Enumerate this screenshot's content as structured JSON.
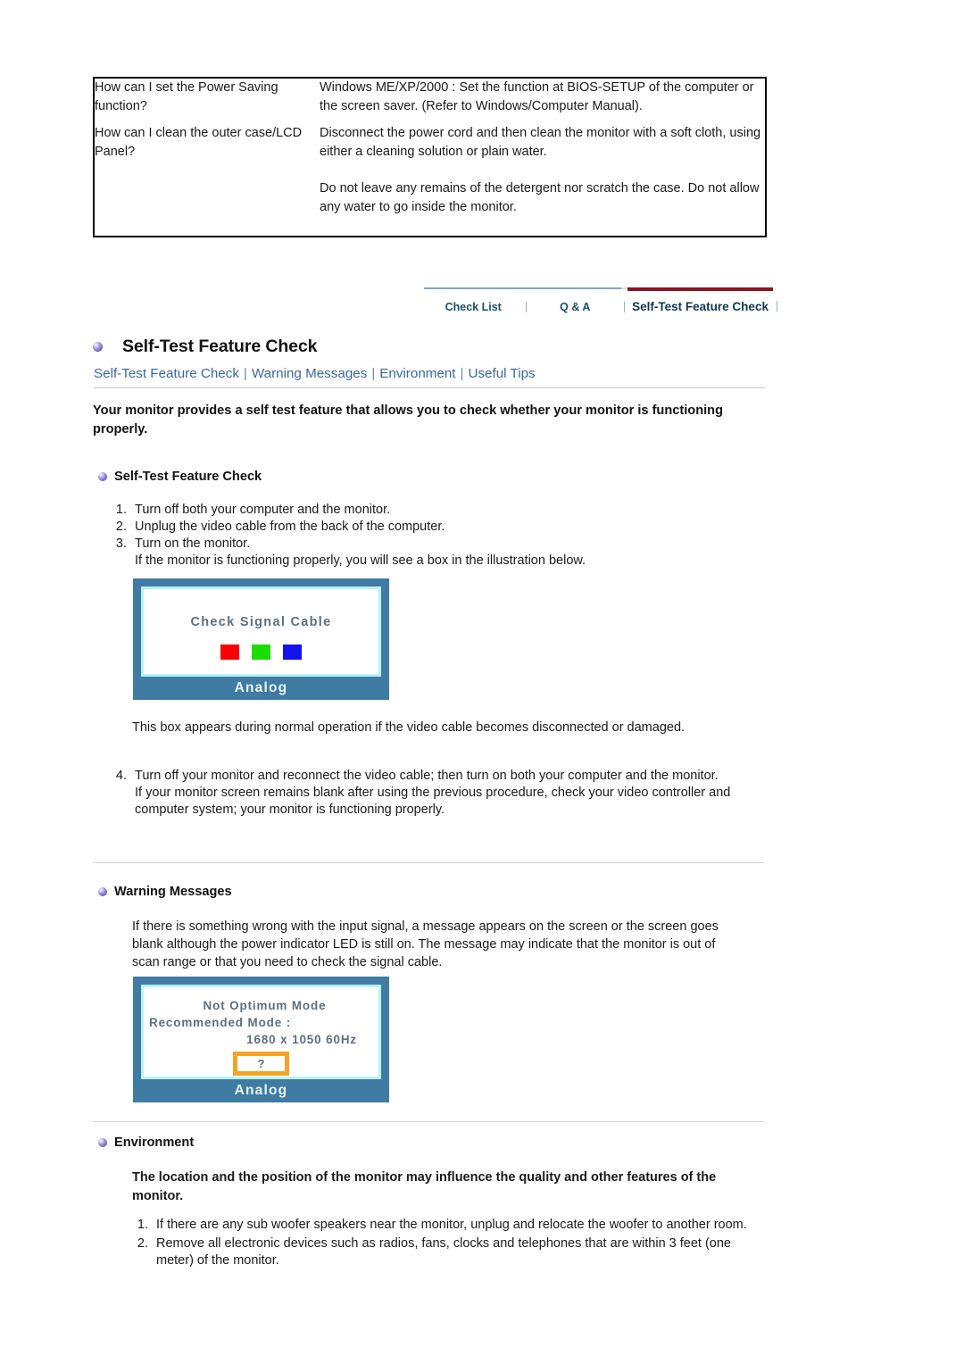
{
  "faq_table": {
    "rows": [
      {
        "question": "How can I set the Power Saving function?",
        "answers": [
          "Windows ME/XP/2000 : Set the function at BIOS-SETUP of the computer or the screen saver. (Refer to Windows/Computer Manual)."
        ]
      },
      {
        "question": "How can I clean the outer case/LCD Panel?",
        "answers": [
          "Disconnect the power cord and then clean the monitor with a soft cloth, using either a cleaning solution or plain water.",
          "Do not leave any remains of the detergent nor scratch the case. Do not allow any water to go inside the monitor."
        ]
      }
    ]
  },
  "tabbar": {
    "tabs": [
      {
        "label": "Check List",
        "active": false
      },
      {
        "label": "Q & A",
        "active": false
      },
      {
        "label": "Self-Test Feature Check",
        "active": true
      }
    ],
    "active_color": "#8c1322",
    "inactive_color": "#7fa8bd",
    "text_color": "#1c4f70"
  },
  "page": {
    "heading": "Self-Test Feature Check",
    "bullet_icon": "purple-sphere-bullet-icon"
  },
  "subnav": {
    "links": [
      "Self-Test Feature Check",
      "Warning Messages",
      "Environment",
      "Useful Tips"
    ],
    "separator": "|",
    "link_color": "#3a67a8"
  },
  "intro": "Your monitor provides a self test feature that allows you to check whether your monitor is functioning properly.",
  "sections": {
    "self_test": {
      "heading": "Self-Test Feature Check",
      "steps": [
        {
          "num": "1.",
          "text": "Turn off both your computer and the monitor."
        },
        {
          "num": "2.",
          "text": "Unplug the video cable from the back of the computer."
        },
        {
          "num": "3.",
          "text": "Turn on the monitor.\nIf the monitor is functioning properly, you will see a box in the illustration below."
        }
      ],
      "after_image_para": "This box appears during normal operation if the video cable becomes disconnected or damaged.",
      "step4": {
        "num": "4.",
        "text": "Turn off your monitor and reconnect the video cable; then turn on both your computer and the monitor.\nIf your monitor screen remains blank after using the previous procedure, check your video controller and computer system; your monitor is functioning properly."
      }
    },
    "warning": {
      "heading": "Warning Messages",
      "paragraph": "If there is something wrong with the input signal, a message appears on the screen or the screen goes blank although the power indicator LED is still on. The message may indicate that the monitor is out of scan range or that you need to check the signal cable."
    },
    "environment": {
      "heading": "Environment",
      "lead": "The location and the position of the monitor may influence the quality and other features of the monitor.",
      "items": [
        {
          "num": "1.",
          "text": "If there are any sub woofer speakers near the monitor, unplug and relocate the woofer to another room."
        },
        {
          "num": "2.",
          "text": "Remove all electronic devices such as radios, fans, clocks and telephones that are within 3 feet (one meter) of the monitor."
        }
      ]
    }
  },
  "illustration_signal": {
    "name": "monitor-osd-check-signal-cable",
    "osd_title": "Check Signal Cable",
    "color_swatches": [
      {
        "name": "red-swatch",
        "hex": "#fb0000"
      },
      {
        "name": "green-swatch",
        "hex": "#1bdd00"
      },
      {
        "name": "blue-swatch",
        "hex": "#1313f0"
      }
    ],
    "footer_label": "Analog",
    "bezel_color": "#3f7ba2",
    "inner_border_color": "#b8f3f5"
  },
  "illustration_mode": {
    "name": "monitor-osd-not-optimum-mode",
    "line1": "Not Optimum Mode",
    "line2": "Recommended Mode :",
    "line3": "1680 x 1050   60Hz",
    "question_mark": "?",
    "qbox_border_color": "#f4a324",
    "footer_label": "Analog",
    "bezel_color": "#3f7ba2",
    "inner_border_color": "#b8f3f5"
  }
}
